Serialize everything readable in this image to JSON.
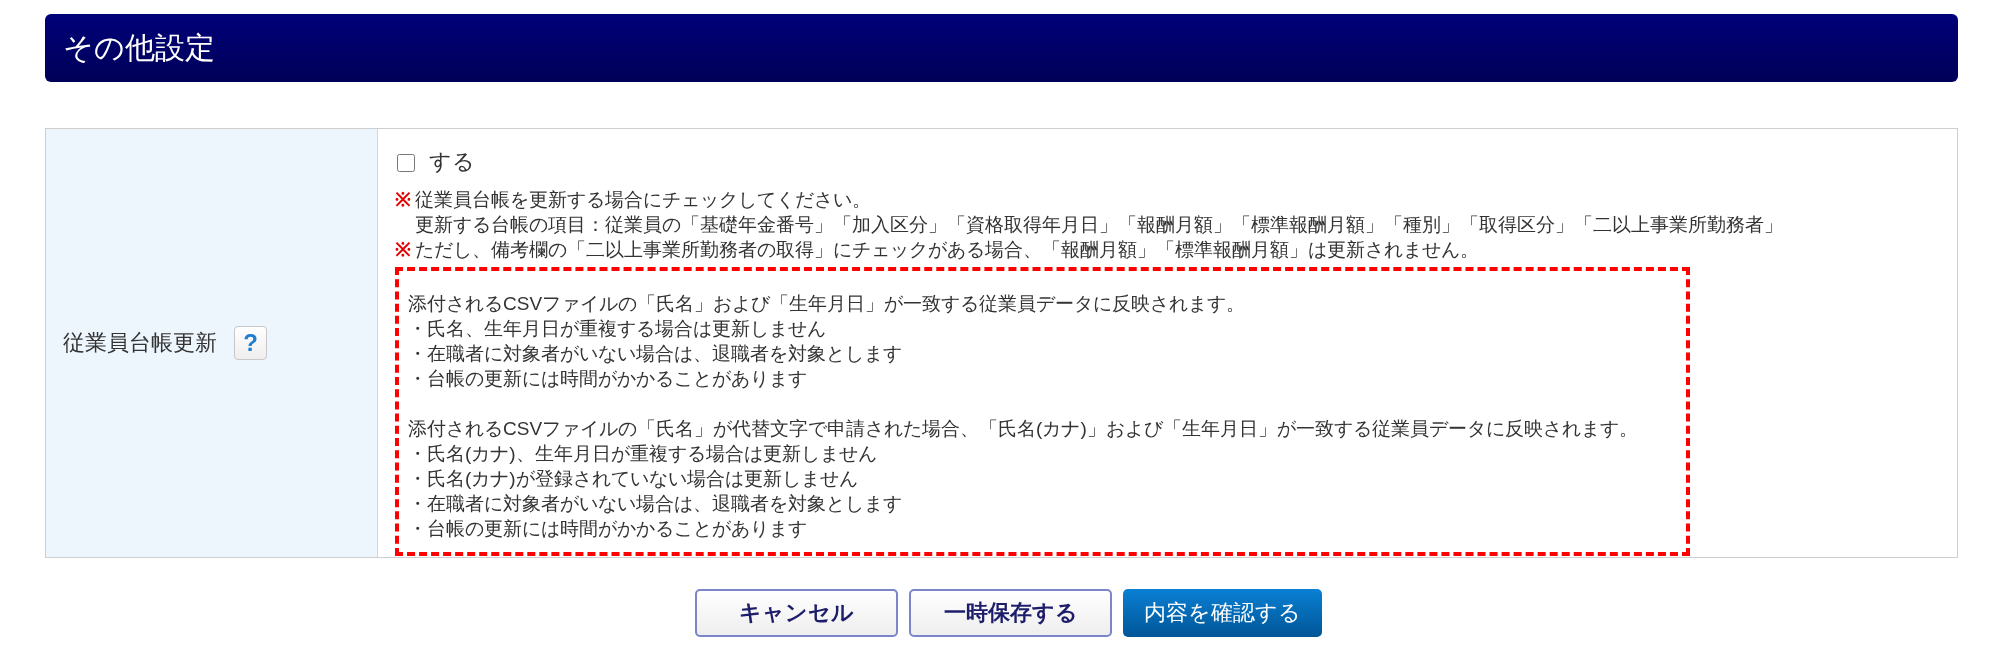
{
  "section": {
    "title": "その他設定"
  },
  "form": {
    "label": "従業員台帳更新",
    "help": "?",
    "checkbox": {
      "label": "する",
      "checked": false
    },
    "notes": [
      {
        "mark": "※",
        "lines": [
          "従業員台帳を更新する場合にチェックしてください。",
          "更新する台帳の項目：従業員の「基礎年金番号」「加入区分」「資格取得年月日」「報酬月額」「標準報酬月額」「種別」「取得区分」「二以上事業所勤務者」"
        ]
      },
      {
        "mark": "※",
        "lines": [
          "ただし、備考欄の「二以上事業所勤務者の取得」にチェックがある場合、「報酬月額」「標準報酬月額」は更新されません。"
        ]
      }
    ],
    "info_box": {
      "paragraphs": [
        {
          "lead": "添付されるCSVファイルの「氏名」および「生年月日」が一致する従業員データに反映されます。",
          "bullets": [
            "・氏名、生年月日が重複する場合は更新しません",
            "・在職者に対象者がいない場合は、退職者を対象とします",
            "・台帳の更新には時間がかかることがあります"
          ]
        },
        {
          "lead": "添付されるCSVファイルの「氏名」が代替文字で申請された場合、「氏名(カナ)」および「生年月日」が一致する従業員データに反映されます。",
          "bullets": [
            "・氏名(カナ)、生年月日が重複する場合は更新しません",
            "・氏名(カナ)が登録されていない場合は更新しません",
            "・在職者に対象者がいない場合は、退職者を対象とします",
            "・台帳の更新には時間がかかることがあります"
          ]
        }
      ]
    }
  },
  "buttons": [
    {
      "label": "キャンセル",
      "kind": "secondary"
    },
    {
      "label": "一時保存する",
      "kind": "secondary"
    },
    {
      "label": "内容を確認する",
      "kind": "primary"
    }
  ]
}
